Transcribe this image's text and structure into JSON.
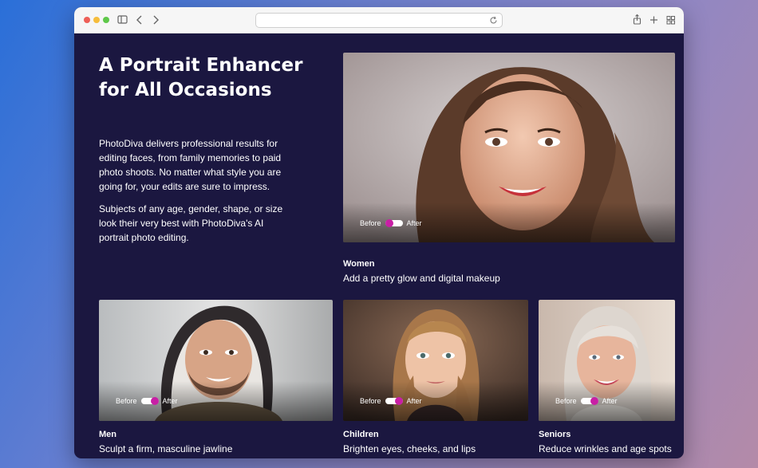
{
  "colors": {
    "page_bg": "#1b1740",
    "accent": "#c81fa5",
    "text": "#ffffff"
  },
  "browser": {
    "address_value": "",
    "icons": [
      "sidebar-icon",
      "back-icon",
      "forward-icon",
      "reload-icon",
      "share-icon",
      "new-tab-icon",
      "tab-overview-icon"
    ]
  },
  "hero": {
    "title": "A Portrait Enhancer for All Occasions",
    "paragraph1": "PhotoDiva delivers professional results for editing faces, from family memories to paid photo shoots. No matter what style you are going for, your edits are sure to impress.",
    "paragraph2": "Subjects of any age, gender, shape, or size look their very best with PhotoDiva's AI portrait photo editing."
  },
  "toggle": {
    "before": "Before",
    "after": "After"
  },
  "cards": [
    {
      "title": "Women",
      "subtitle": "Add a pretty glow and digital makeup",
      "toggle_state": "before"
    },
    {
      "title": "Men",
      "subtitle": "Sculpt a firm, masculine jawline",
      "toggle_state": "after"
    },
    {
      "title": "Children",
      "subtitle": "Brighten eyes, cheeks, and lips",
      "toggle_state": "after"
    },
    {
      "title": "Seniors",
      "subtitle": "Reduce wrinkles and age spots",
      "toggle_state": "after"
    }
  ]
}
